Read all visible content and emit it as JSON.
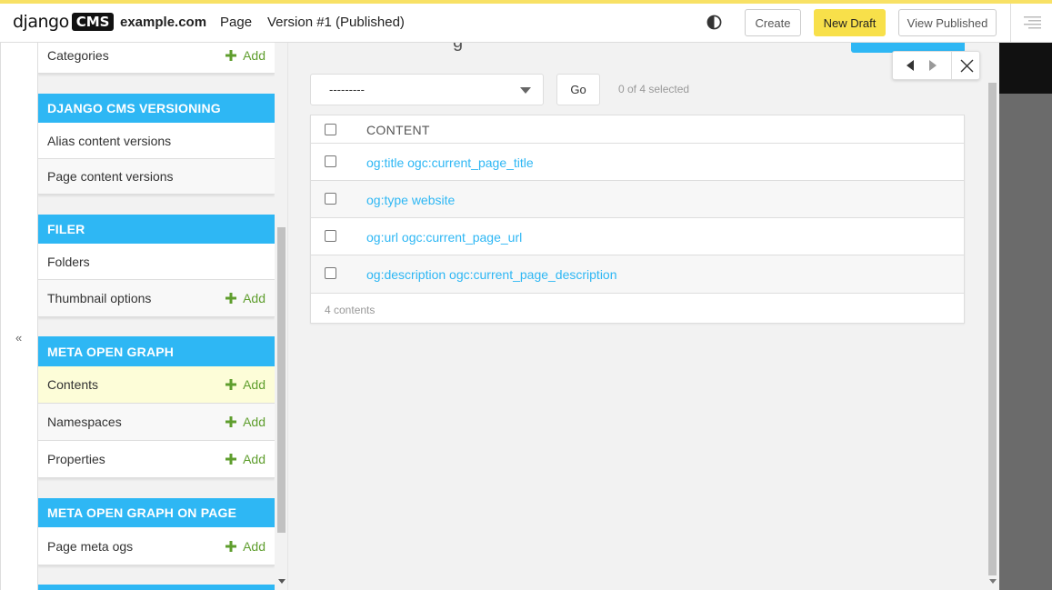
{
  "toolbar": {
    "logo_text": "django",
    "logo_badge": "CMS",
    "site": "example.com",
    "page_menu": "Page",
    "version": "Version #1 (Published)",
    "create_label": "Create",
    "new_draft_label": "New Draft",
    "view_published_label": "View Published"
  },
  "sidebar": {
    "collapse_label": "«",
    "partial_row": {
      "label": "Categories",
      "add": "Add"
    },
    "sections": [
      {
        "title": "DJANGO CMS VERSIONING",
        "items": [
          {
            "label": "Alias content versions"
          },
          {
            "label": "Page content versions"
          }
        ]
      },
      {
        "title": "FILER",
        "items": [
          {
            "label": "Folders"
          },
          {
            "label": "Thumbnail options",
            "add": "Add"
          }
        ]
      },
      {
        "title": "META OPEN GRAPH",
        "items": [
          {
            "label": "Contents",
            "add": "Add"
          },
          {
            "label": "Namespaces",
            "add": "Add"
          },
          {
            "label": "Properties",
            "add": "Add"
          }
        ]
      },
      {
        "title": "META OPEN GRAPH ON PAGE",
        "items": [
          {
            "label": "Page meta ogs",
            "add": "Add"
          }
        ]
      }
    ]
  },
  "main": {
    "partial_title": "g",
    "action": {
      "selected": "---------",
      "go_label": "Go",
      "selection_count": "0 of 4 selected"
    },
    "table": {
      "column_header": "CONTENT",
      "rows": [
        "og:title ogc:current_page_title",
        "og:type website",
        "og:url ogc:current_page_url",
        "og:description ogc:current_page_description"
      ],
      "footer": "4 contents"
    }
  },
  "colors": {
    "accent": "#2eb7f4",
    "add_green": "#5f9e2e",
    "toolbar_yellow": "#f8e04a",
    "highlight_row": "#fdfdd8"
  }
}
